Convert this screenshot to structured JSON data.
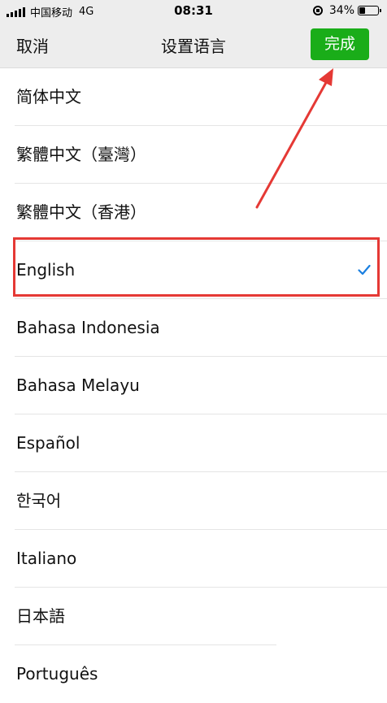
{
  "status_bar": {
    "carrier": "中国移动",
    "network": "4G",
    "time": "08:31",
    "battery_percent_text": "34%",
    "battery_level": 0.34
  },
  "nav": {
    "cancel_label": "取消",
    "title": "设置语言",
    "done_label": "完成"
  },
  "languages": [
    {
      "label": "简体中文",
      "selected": false
    },
    {
      "label": "繁體中文（臺灣）",
      "selected": false
    },
    {
      "label": "繁體中文（香港）",
      "selected": false
    },
    {
      "label": "English",
      "selected": true
    },
    {
      "label": "Bahasa Indonesia",
      "selected": false
    },
    {
      "label": "Bahasa Melayu",
      "selected": false
    },
    {
      "label": "Español",
      "selected": false
    },
    {
      "label": "한국어",
      "selected": false
    },
    {
      "label": "Italiano",
      "selected": false
    },
    {
      "label": "日本語",
      "selected": false
    },
    {
      "label": "Português",
      "selected": false
    }
  ],
  "icons": {
    "selected_check": "checkmark-icon",
    "annotation_arrow": "arrow-icon"
  },
  "colors": {
    "accent_green": "#1aad19",
    "check_blue": "#1a7fe0",
    "annotation_red": "#e53935"
  }
}
